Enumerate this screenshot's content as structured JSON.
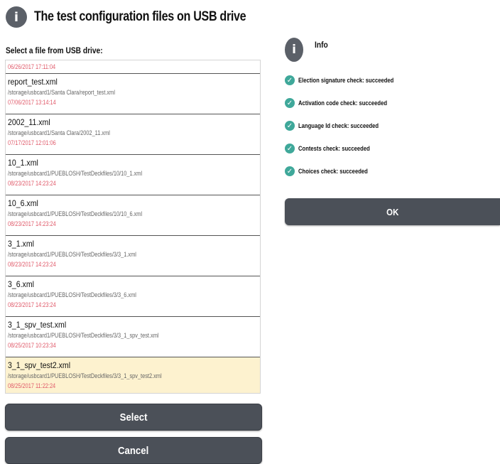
{
  "header": {
    "icon": "info-icon",
    "title": "The test configuration files on USB drive"
  },
  "file_select_label": "Select a file from USB drive:",
  "files": [
    {
      "date": "06/26/2017 17:11:04"
    },
    {
      "name": "report_test.xml",
      "path": "/storage/usbcard1/Santa Clara/report_test.xml",
      "date": "07/06/2017 13:14:14"
    },
    {
      "name": "2002_11.xml",
      "path": "/storage/usbcard1/Santa Clara/2002_11.xml",
      "date": "07/17/2017 12:01:06"
    },
    {
      "name": "10_1.xml",
      "path": "/storage/usbcard1/PUEBLOSH/TestDeckfiles/10/10_1.xml",
      "date": "08/23/2017 14:23:24"
    },
    {
      "name": "10_6.xml",
      "path": "/storage/usbcard1/PUEBLOSH/TestDeckfiles/10/10_6.xml",
      "date": "08/23/2017 14:23:24"
    },
    {
      "name": "3_1.xml",
      "path": "/storage/usbcard1/PUEBLOSH/TestDeckfiles/3/3_1.xml",
      "date": "08/23/2017 14:23:24"
    },
    {
      "name": "3_6.xml",
      "path": "/storage/usbcard1/PUEBLOSH/TestDeckfiles/3/3_6.xml",
      "date": "08/23/2017 14:23:24"
    },
    {
      "name": "3_1_spv_test.xml",
      "path": "/storage/usbcard1/PUEBLOSH/TestDeckfiles/3/3_1_spv_test.xml",
      "date": "08/25/2017 10:23:34"
    },
    {
      "name": "3_1_spv_test2.xml",
      "path": "/storage/usbcard1/PUEBLOSH/TestDeckfiles/3/3_1_spv_test2.xml",
      "date": "08/25/2017 11:22:24"
    }
  ],
  "selected_file": "3_1_spv_test2.xml",
  "buttons": {
    "select": "Select",
    "cancel": "Cancel",
    "ok": "OK"
  },
  "info": {
    "icon": "info-icon",
    "title": "Info",
    "checks": [
      "Election signature check: succeeded",
      "Activation code check: succeeded",
      "Language Id check: succeeded",
      "Contests check: succeeded",
      "Choices check: succeeded"
    ]
  },
  "colors": {
    "button_bg": "#4b5058",
    "selected_row_bg": "#fdf2cf",
    "date_text": "#e05a6a",
    "check_icon": "#3fa89a"
  }
}
